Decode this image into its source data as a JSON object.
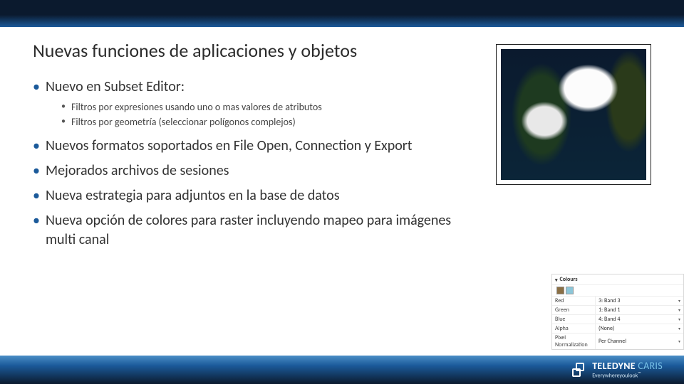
{
  "title": "Nuevas funciones de aplicaciones y objetos",
  "bullets": {
    "b0": "Nuevo en Subset Editor:",
    "b0_sub0": "Filtros por expresiones usando uno o mas valores de atributos",
    "b0_sub1": "Filtros por geometría (seleccionar polígonos complejos)",
    "b1": "Nuevos formatos soportados en File Open, Connection y Export",
    "b2": "Mejorados archivos de sesiones",
    "b3": "Nueva estrategia para adjuntos en la base de datos",
    "b4": "Nueva opción de colores para raster incluyendo mapeo para imágenes multi canal"
  },
  "panel": {
    "header": "Colours",
    "rows": [
      {
        "label": "Red",
        "value": "3: Band 3"
      },
      {
        "label": "Green",
        "value": "1: Band 1"
      },
      {
        "label": "Blue",
        "value": "4: Band 4"
      },
      {
        "label": "Alpha",
        "value": "(None)"
      },
      {
        "label": "Pixel Normalization",
        "value": "Per Channel"
      }
    ]
  },
  "brand": {
    "name_a": "TELEDYNE ",
    "name_b": "CARIS",
    "tagline": "Everywhereyoulook",
    "tm": "™"
  }
}
